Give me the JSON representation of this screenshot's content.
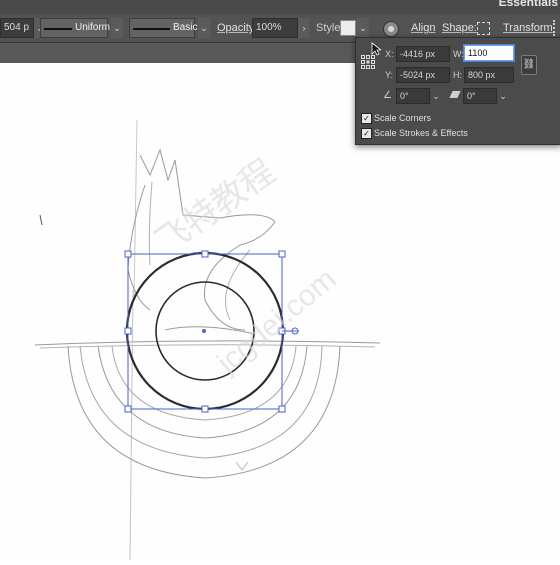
{
  "window": {
    "workspace_label": "Essentials"
  },
  "toolbar": {
    "stroke_weight_value": "504 p",
    "variable_width_profile": "Uniform",
    "brush_definition": "Basic",
    "opacity_label": "Opacity:",
    "opacity_value": "100%",
    "style_label": "Style:",
    "align_label": "Align",
    "shape_label": "Shape:",
    "transform_label": "Transform"
  },
  "transform_panel": {
    "x_label": "X:",
    "x_value": "-4416 px",
    "y_label": "Y:",
    "y_value": "-5024 px",
    "w_label": "W:",
    "w_value": "1100",
    "h_label": "H:",
    "h_value": "800 px",
    "rotate_value": "0°",
    "shear_value": "0°",
    "scale_corners_label": "Scale Corners",
    "scale_corners_checked": true,
    "scale_strokes_label": "Scale Strokes & Effects",
    "scale_strokes_checked": true
  },
  "watermark": {
    "chinese": "飞特教程",
    "domain": "jcgdei.com"
  },
  "icons": {
    "reference_point": "reference-point-grid-icon",
    "constrain": "chain-link-icon",
    "rotate": "rotate-angle-icon",
    "shear": "shear-icon",
    "recolor": "recolor-artwork-icon",
    "shape": "shape-bounds-icon"
  }
}
